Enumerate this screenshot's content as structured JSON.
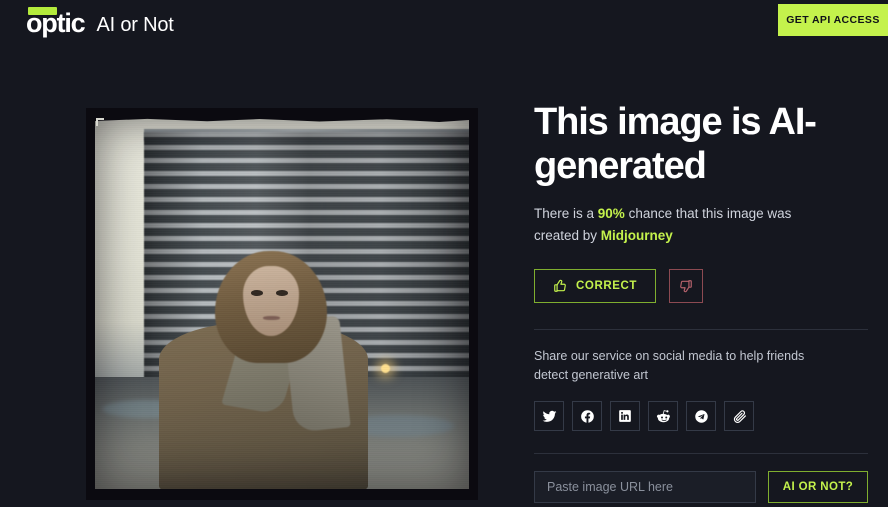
{
  "header": {
    "logo_text": "optic",
    "logo_accent_color": "#b4eb3c",
    "brand_sub": "AI or Not",
    "api_button_label": "GET API ACCESS",
    "api_button_color": "#c4f24c"
  },
  "result": {
    "headline": "This image is AI-generated",
    "subline_prefix": "There is a ",
    "confidence": "90%",
    "subline_middle": " chance that this image was created by ",
    "generator": "Midjourney",
    "correct_label": "CORRECT",
    "correct_icon": "thumbs-up-icon",
    "dislike_icon": "thumbs-down-icon",
    "accent_color": "#c4f24c",
    "negative_color": "#8d4a52"
  },
  "share": {
    "text": "Share our service on social media to help friends detect generative art",
    "icons": [
      {
        "name": "twitter-icon",
        "label": "Twitter"
      },
      {
        "name": "facebook-icon",
        "label": "Facebook"
      },
      {
        "name": "linkedin-icon",
        "label": "LinkedIn"
      },
      {
        "name": "reddit-icon",
        "label": "Reddit"
      },
      {
        "name": "telegram-icon",
        "label": "Telegram"
      },
      {
        "name": "link-icon",
        "label": "Copy link"
      }
    ]
  },
  "url_form": {
    "placeholder": "Paste image URL here",
    "value": "",
    "submit_label": "AI OR NOT?"
  },
  "image_preview": {
    "description": "Analyzed photo: young woman in a wool coat standing in front of a large brutalist apartment block on wet pavement, overcast pale sky"
  }
}
